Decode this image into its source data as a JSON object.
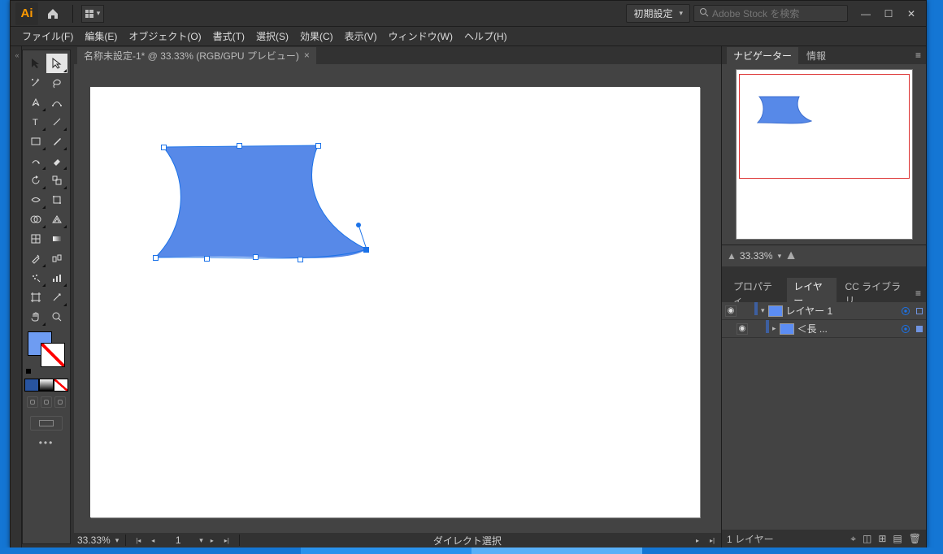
{
  "titlebar": {
    "logo": "Ai",
    "essentials_label": "初期設定",
    "search_placeholder": "Adobe Stock を検索"
  },
  "menus": {
    "file": "ファイル(F)",
    "edit": "編集(E)",
    "object": "オブジェクト(O)",
    "type": "書式(T)",
    "select": "選択(S)",
    "effect": "効果(C)",
    "view": "表示(V)",
    "window": "ウィンドウ(W)",
    "help": "ヘルプ(H)"
  },
  "doc": {
    "tab_label": "名称未設定-1* @ 33.33% (RGB/GPU プレビュー)",
    "close": "×"
  },
  "status": {
    "zoom": "33.33%",
    "artboard_num": "1",
    "tool": "ダイレクト選択"
  },
  "panels": {
    "nav_tab": "ナビゲーター",
    "info_tab": "情報",
    "nav_zoom": "33.33%",
    "props_tab": "プロパティ",
    "layers_tab": "レイヤー",
    "cc_tab": "CC ライブラリ",
    "layer1_name": "レイヤー 1",
    "layer1_sub": "＜長 ...",
    "footer_count": "1 レイヤー"
  },
  "left_strip_chev": "«"
}
